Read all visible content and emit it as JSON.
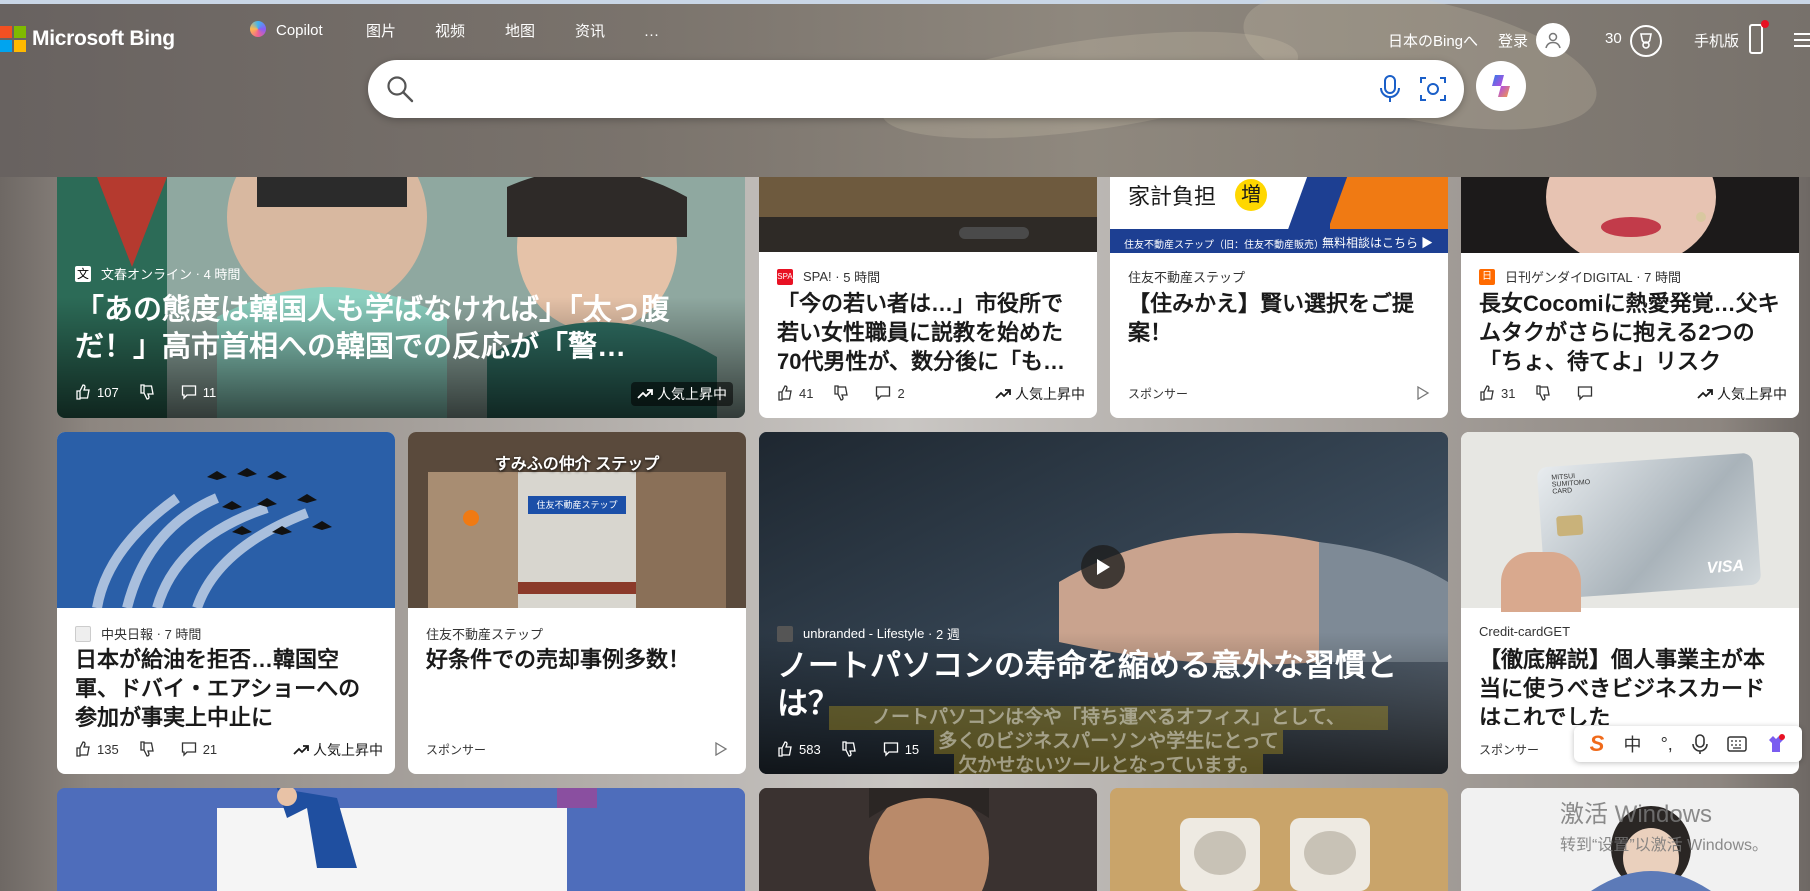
{
  "colors": {
    "brand_red": "#f25022",
    "brand_green": "#7fba00",
    "brand_blue": "#00a4ef",
    "brand_yellow": "#ffb900",
    "trend_red": "#e81123"
  },
  "header": {
    "logo_text": "Microsoft Bing",
    "nav": [
      {
        "label": "Copilot",
        "icon": "copilot-icon"
      },
      {
        "label": "图片"
      },
      {
        "label": "视频"
      },
      {
        "label": "地图"
      },
      {
        "label": "资讯"
      },
      {
        "label": "···"
      }
    ],
    "region_link": "日本のBingへ",
    "login": "登录",
    "points": "30",
    "mobile": "手机版"
  },
  "search": {
    "placeholder": "",
    "value": ""
  },
  "cards": {
    "c1": {
      "source": "文春オンライン",
      "time": "4 時間",
      "title": "「あの態度は韓国人も学ばなければ」「太っ腹だ！」高市首相への韓国での反応が「警…",
      "likes": "107",
      "comments": "11",
      "trend": "人気上昇中"
    },
    "c2": {
      "source": "SPA!",
      "time": "5 時間",
      "title": "「今の若い者は…」市役所で若い女性職員に説教を始めた70代男性が、数分後に「も…",
      "likes": "41",
      "comments": "2",
      "trend": "人気上昇中"
    },
    "c3": {
      "source": "住友不動産ステップ",
      "title": "【住みかえ】賢い選択をご提案！",
      "sponsor": "スポンサー",
      "ad_headline": "家計負担",
      "ad_badge": "増",
      "ad_footer_left": "住友不動産ステップ（旧：住友不動産販売）",
      "ad_footer_right": "無料相談はこちら ▶"
    },
    "c4": {
      "source": "日刊ゲンダイDIGITAL",
      "time": "7 時間",
      "title": "長女Cocomiに熱愛発覚…父キムタクがさらに抱える2つの「ちょ、待てよ」リスク",
      "likes": "31",
      "comments": "",
      "trend": "人気上昇中"
    },
    "c5": {
      "source": "中央日報",
      "time": "7 時間",
      "title": "日本が給油を拒否…韓国空軍、ドバイ・エアショーへの参加が事実上中止に",
      "likes": "135",
      "comments": "21",
      "trend": "人気上昇中"
    },
    "c6": {
      "source": "住友不動産ステップ",
      "title": "好条件での売却事例多数！",
      "sponsor": "スポンサー",
      "img_caption": "すみふの仲介 ステップ",
      "sign": "住友不動産ステップ"
    },
    "c7": {
      "source": "unbranded - Lifestyle",
      "time": "2 週",
      "title": "ノートパソコンの寿命を縮める意外な習慣とは？",
      "subtitle_lines": [
        "ノートパソコンは今や「持ち運べるオフィス」として、",
        "多くのビジネスパーソンや学生にとって",
        "欠かせないツールとなっています。"
      ],
      "likes": "583",
      "comments": "15"
    },
    "c8": {
      "source": "Credit-cardGET",
      "title": "【徹底解説】個人事業主が本当に使うべきビジネスカードはこれでした",
      "sponsor": "スポンサー",
      "card_brand": "VISA",
      "card_issuer": "MITSUI SUMITOMO CARD"
    }
  },
  "ime": {
    "items": [
      "S",
      "中",
      "°,",
      "mic",
      "kbd",
      "skin"
    ]
  },
  "watermark": {
    "line1": "激活 Windows",
    "line2": "转到“设置”以激活 Windows。"
  }
}
